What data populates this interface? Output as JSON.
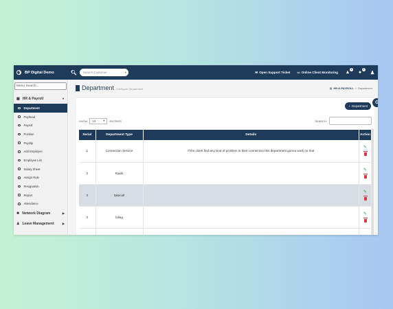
{
  "header": {
    "brand": "BP Digital Demo",
    "search_placeholder": "Search Customer",
    "support_label": "Open Support Ticket",
    "monitoring_label": "Online Client Monitoring",
    "notif_count": "1",
    "help_count": "2"
  },
  "sidebar": {
    "menu_search": "Menu Search...",
    "groups": [
      {
        "label": "HR & Payroll"
      },
      {
        "label": "Network Diagram"
      },
      {
        "label": "Leave Management"
      }
    ],
    "items": [
      {
        "label": "Department"
      },
      {
        "label": "Payhead"
      },
      {
        "label": "Payroll"
      },
      {
        "label": "Position"
      },
      {
        "label": "Payslip"
      },
      {
        "label": "Add Employee"
      },
      {
        "label": "Employee List"
      },
      {
        "label": "Salary Sheet"
      },
      {
        "label": "Assign Rule"
      },
      {
        "label": "Resignation"
      },
      {
        "label": "Report"
      },
      {
        "label": "Attendance"
      }
    ]
  },
  "page": {
    "title": "Department",
    "subtitle": "Configure Department",
    "crumb_home": "HR & PAYROLL",
    "crumb_sep": ">",
    "crumb_current": "Department",
    "add_button": "Department"
  },
  "table": {
    "show_label": "SHOW",
    "page_size": "10",
    "entries_label": "ENTRIES",
    "search_label": "SEARCH:",
    "columns": [
      "Serial",
      "Department Type",
      "Details",
      "Action"
    ],
    "rows": [
      {
        "serial": "1",
        "type": "Connection Service",
        "details": "If the client find any kind of problem in their connection this department gonna work on that"
      },
      {
        "serial": "2",
        "type": "Raids",
        "details": ""
      },
      {
        "serial": "3",
        "type": "takecall",
        "details": ""
      },
      {
        "serial": "4",
        "type": "biling",
        "details": ""
      }
    ]
  },
  "colors": {
    "primary": "#1f3b5a",
    "edit": "#2e9c3a",
    "delete": "#d9363e"
  }
}
